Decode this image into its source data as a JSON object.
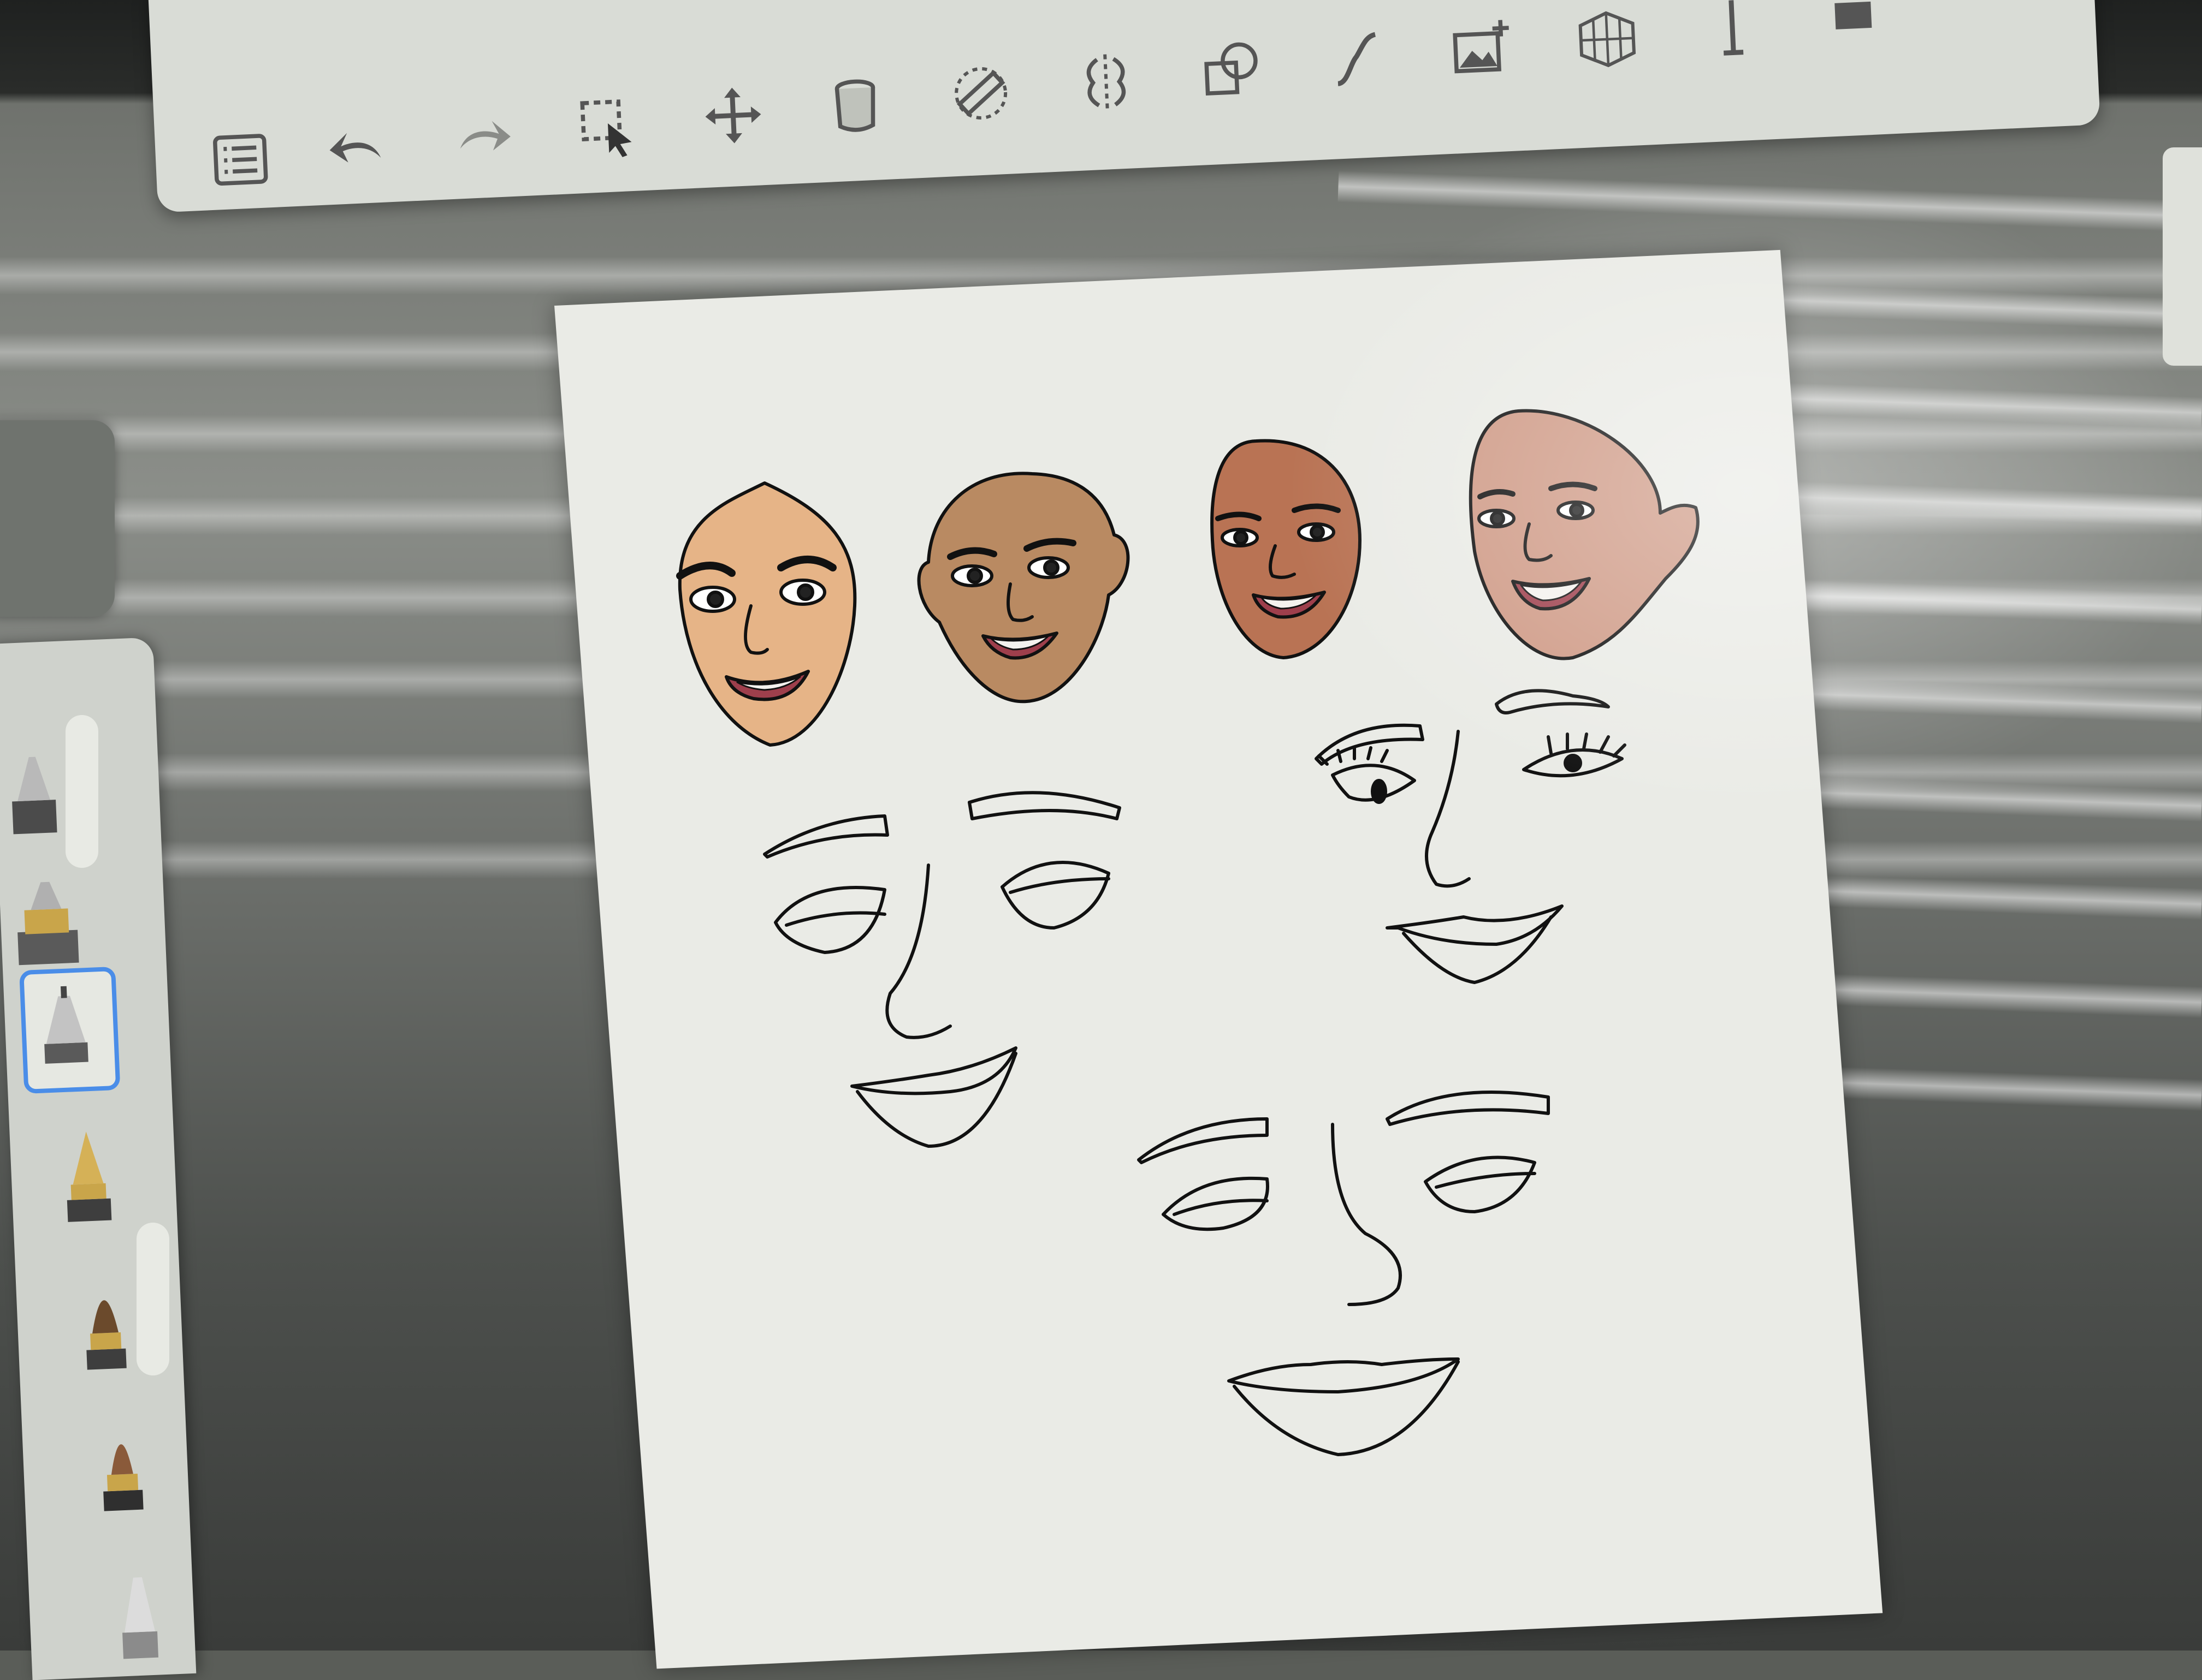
{
  "app": {
    "name": ""
  },
  "toolbar": {
    "icons": [
      "layers-list-icon",
      "undo-icon",
      "redo-icon",
      "selection-icon",
      "transform-move-icon",
      "paint-bucket-icon",
      "ruler-guide-icon",
      "symmetry-icon",
      "shapes-icon",
      "curve-stroke-icon",
      "image-import-icon",
      "perspective-grid-icon",
      "text-icon",
      "more-icon"
    ]
  },
  "brushes": [
    "pencil-brush-icon",
    "marker-brush-icon",
    "inking-pen-brush-icon",
    "fountain-pen-brush-icon",
    "paint-brush-icon",
    "watercolor-brush-icon",
    "airbrush-icon"
  ],
  "selected_brush": "inking-pen-brush-icon",
  "canvas": {
    "colors": {
      "paper": "#eaebe6",
      "ink": "#111111",
      "skin_tone_1": "#e6b487",
      "skin_tone_2": "#b98a62",
      "skin_tone_3": "#b97354",
      "skin_tone_4": "#cf9a86",
      "lip": "#9e3f4c",
      "teeth": "#f4f2ee",
      "selection_accent": "#4a8de8"
    }
  }
}
